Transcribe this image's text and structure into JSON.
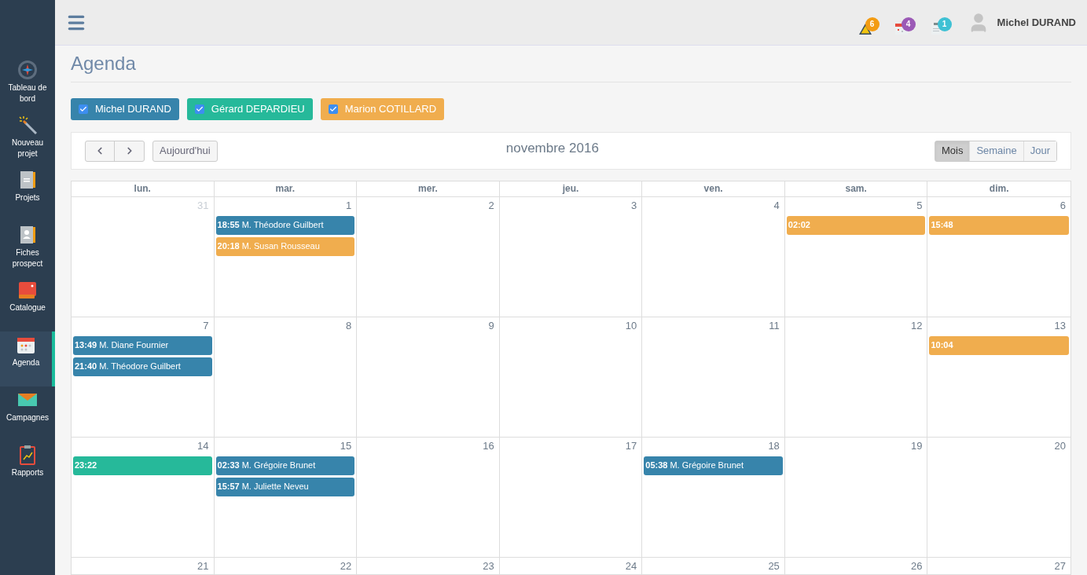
{
  "sidebar": {
    "items": [
      {
        "label": "Tableau de bord",
        "selected": false
      },
      {
        "label": "Nouveau projet",
        "selected": false
      },
      {
        "label": "Projets",
        "selected": false
      },
      {
        "label": "Fiches prospect",
        "selected": false
      },
      {
        "label": "Catalogue",
        "selected": false
      },
      {
        "label": "Agenda",
        "selected": true
      },
      {
        "label": "Campagnes",
        "selected": false
      },
      {
        "label": "Rapports",
        "selected": false
      }
    ]
  },
  "topbar": {
    "notifications": [
      {
        "count": "6",
        "color": "#f39c12"
      },
      {
        "count": "4",
        "color": "#9b59b6"
      },
      {
        "count": "1",
        "color": "#3fc1d4"
      }
    ],
    "user": "Michel DURAND"
  },
  "page": {
    "title": "Agenda"
  },
  "calendars": [
    {
      "name": "Michel DURAND",
      "color": "#3784ab",
      "checked": true
    },
    {
      "name": "Gérard DEPARDIEU",
      "color": "#26b99a",
      "checked": true
    },
    {
      "name": "Marion COTILLARD",
      "color": "#f0ad4e",
      "checked": true
    }
  ],
  "toolbar": {
    "today": "Aujourd'hui",
    "title": "novembre 2016",
    "views": [
      {
        "label": "Mois",
        "selected": true
      },
      {
        "label": "Semaine",
        "selected": false
      },
      {
        "label": "Jour",
        "selected": false
      }
    ]
  },
  "weekdays": [
    "lun.",
    "mar.",
    "mer.",
    "jeu.",
    "ven.",
    "sam.",
    "dim."
  ],
  "weeks": [
    {
      "days": [
        {
          "number": "31",
          "other_month": true
        },
        {
          "number": "1",
          "other_month": false,
          "events": [
            {
              "time": "18:55",
              "title": "M. Théodore Guilbert",
              "color": "#3784ab"
            },
            {
              "time": "20:18",
              "title": "M. Susan Rousseau",
              "color": "#f0ad4e"
            }
          ]
        },
        {
          "number": "2",
          "other_month": false
        },
        {
          "number": "3",
          "other_month": false
        },
        {
          "number": "4",
          "other_month": false
        },
        {
          "number": "5",
          "other_month": false,
          "events": [
            {
              "time": "02:02",
              "color": "#f0ad4e"
            }
          ]
        },
        {
          "number": "6",
          "other_month": false,
          "events": [
            {
              "time": "15:48",
              "color": "#f0ad4e"
            }
          ]
        }
      ]
    },
    {
      "days": [
        {
          "number": "7",
          "other_month": false,
          "events": [
            {
              "time": "13:49",
              "title": "M. Diane Fournier",
              "color": "#3784ab"
            },
            {
              "time": "21:40",
              "title": "M. Théodore Guilbert",
              "color": "#3784ab"
            }
          ]
        },
        {
          "number": "8",
          "other_month": false
        },
        {
          "number": "9",
          "other_month": false
        },
        {
          "number": "10",
          "other_month": false
        },
        {
          "number": "11",
          "other_month": false
        },
        {
          "number": "12",
          "other_month": false
        },
        {
          "number": "13",
          "other_month": false,
          "events": [
            {
              "time": "10:04",
              "color": "#f0ad4e"
            }
          ]
        }
      ]
    },
    {
      "days": [
        {
          "number": "14",
          "other_month": false,
          "events": [
            {
              "time": "23:22",
              "color": "#26b99a"
            }
          ]
        },
        {
          "number": "15",
          "other_month": false,
          "events": [
            {
              "time": "02:33",
              "title": "M. Grégoire Brunet",
              "color": "#3784ab"
            },
            {
              "time": "15:57",
              "title": "M. Juliette Neveu",
              "color": "#3784ab"
            }
          ]
        },
        {
          "number": "16",
          "other_month": false
        },
        {
          "number": "17",
          "other_month": false
        },
        {
          "number": "18",
          "other_month": false,
          "events": [
            {
              "time": "05:38",
              "title": "M. Grégoire Brunet",
              "color": "#3784ab"
            }
          ]
        },
        {
          "number": "19",
          "other_month": false
        },
        {
          "number": "20",
          "other_month": false
        }
      ]
    },
    {
      "days": [
        {
          "number": "21",
          "other_month": false
        },
        {
          "number": "22",
          "other_month": false
        },
        {
          "number": "23",
          "other_month": false
        },
        {
          "number": "24",
          "other_month": false
        },
        {
          "number": "25",
          "other_month": false
        },
        {
          "number": "26",
          "other_month": false
        },
        {
          "number": "27",
          "other_month": false
        }
      ]
    }
  ]
}
